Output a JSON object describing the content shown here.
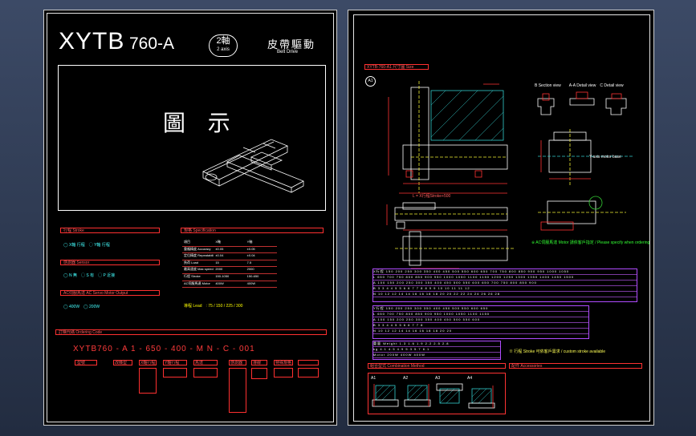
{
  "left_sheet": {
    "model": "XYTB",
    "model_number": "760-A",
    "axis_count": "2軸",
    "axis_count_en": "2 axis",
    "drive_cn": "皮帶驅動",
    "drive_en": "Belt Drive",
    "figure_label": "圖 示",
    "section_stroke": "行程 Stroke",
    "section_spec": "規格 Specification",
    "section_sensor": "感測器 Sensor",
    "section_motor_output": "AC伺服馬達 AC Servo Motor Output",
    "section_ordering": "訂購代碼 Ordering Code",
    "order_code": "XYTB760 - A    1  -  650 - 400  -  M  N  -  C  -  001",
    "spec_header": [
      "項目",
      "X軸",
      "Y軸"
    ],
    "spec_rows": [
      [
        "重複精度 Accuracy",
        "±0.05",
        "±0.05"
      ],
      [
        "定位精度 Repeatability",
        "±0.04",
        "±0.04"
      ],
      [
        "負荷 Load",
        "15",
        "7.5"
      ],
      [
        "最高速度 Max speed",
        "2000",
        "2000"
      ],
      [
        "行程 Stroke",
        "150-1050",
        "150-650"
      ],
      [
        "AC伺服馬達 Motor",
        "400W",
        "400W"
      ]
    ],
    "order_fields": [
      "型號",
      "改機型",
      "X軸行程",
      "Y軸行程",
      "馬達",
      "感測器",
      "導線",
      "特殊規格"
    ]
  },
  "right_sheet": {
    "section_title": "XYTB-760-A1 尺寸圖 Size",
    "view_label": "A1",
    "bottom_section_left": "組合型式 Combination Method",
    "bottom_section_right": "配件 Accessories",
    "combo_labels": [
      "A1",
      "A2",
      "A3",
      "A4"
    ],
    "note": "※ AC伺服馬達 Motor 請依客戶指定 / Please specify when ordering"
  },
  "colors": {
    "background": "#000000",
    "frame": "#2b3a55",
    "red": "#ff3030",
    "cyan": "#44ffff",
    "magenta": "#b04cff"
  }
}
